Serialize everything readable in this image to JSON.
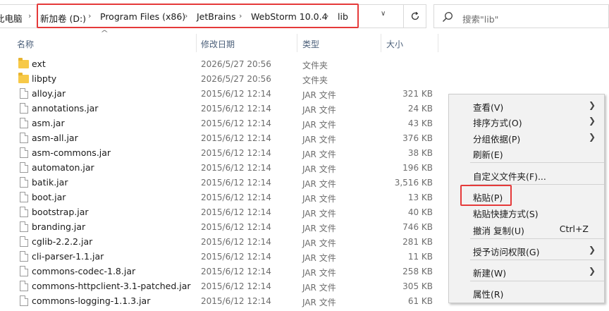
{
  "address_bar": {
    "crumbs": [
      "此电脑",
      "新加卷 (D:)",
      "Program Files (x86)",
      "JetBrains",
      "WebStorm 10.0.4",
      "lib"
    ]
  },
  "search": {
    "placeholder": "搜索\"lib\""
  },
  "columns": {
    "name": "名称",
    "date": "修改日期",
    "type": "类型",
    "size": "大小"
  },
  "files": [
    {
      "name": "ext",
      "date": "2026/5/27 20:56",
      "type": "文件夹",
      "size": "",
      "kind": "folder"
    },
    {
      "name": "libpty",
      "date": "2026/5/27 20:56",
      "type": "文件夹",
      "size": "",
      "kind": "folder"
    },
    {
      "name": "alloy.jar",
      "date": "2015/6/12 12:14",
      "type": "JAR 文件",
      "size": "321 KB",
      "kind": "file"
    },
    {
      "name": "annotations.jar",
      "date": "2015/6/12 12:14",
      "type": "JAR 文件",
      "size": "24 KB",
      "kind": "file"
    },
    {
      "name": "asm.jar",
      "date": "2015/6/12 12:14",
      "type": "JAR 文件",
      "size": "43 KB",
      "kind": "file"
    },
    {
      "name": "asm-all.jar",
      "date": "2015/6/12 12:14",
      "type": "JAR 文件",
      "size": "376 KB",
      "kind": "file"
    },
    {
      "name": "asm-commons.jar",
      "date": "2015/6/12 12:14",
      "type": "JAR 文件",
      "size": "38 KB",
      "kind": "file"
    },
    {
      "name": "automaton.jar",
      "date": "2015/6/12 12:14",
      "type": "JAR 文件",
      "size": "196 KB",
      "kind": "file"
    },
    {
      "name": "batik.jar",
      "date": "2015/6/12 12:14",
      "type": "JAR 文件",
      "size": "3,516 KB",
      "kind": "file"
    },
    {
      "name": "boot.jar",
      "date": "2015/6/12 12:14",
      "type": "JAR 文件",
      "size": "13 KB",
      "kind": "file"
    },
    {
      "name": "bootstrap.jar",
      "date": "2015/6/12 12:14",
      "type": "JAR 文件",
      "size": "40 KB",
      "kind": "file"
    },
    {
      "name": "branding.jar",
      "date": "2015/6/12 12:14",
      "type": "JAR 文件",
      "size": "746 KB",
      "kind": "file"
    },
    {
      "name": "cglib-2.2.2.jar",
      "date": "2015/6/12 12:14",
      "type": "JAR 文件",
      "size": "281 KB",
      "kind": "file"
    },
    {
      "name": "cli-parser-1.1.jar",
      "date": "2015/6/12 12:14",
      "type": "JAR 文件",
      "size": "11 KB",
      "kind": "file"
    },
    {
      "name": "commons-codec-1.8.jar",
      "date": "2015/6/12 12:14",
      "type": "JAR 文件",
      "size": "258 KB",
      "kind": "file"
    },
    {
      "name": "commons-httpclient-3.1-patched.jar",
      "date": "2015/6/12 12:14",
      "type": "JAR 文件",
      "size": "305 KB",
      "kind": "file"
    },
    {
      "name": "commons-logging-1.1.3.jar",
      "date": "2015/6/12 12:14",
      "type": "JAR 文件",
      "size": "61 KB",
      "kind": "file"
    }
  ],
  "context_menu": {
    "view": "查看(V)",
    "sort_by": "排序方式(O)",
    "group_by": "分组依据(P)",
    "refresh": "刷新(E)",
    "customize_folder": "自定义文件夹(F)...",
    "paste": "粘贴(P)",
    "paste_shortcut": "粘贴快捷方式(S)",
    "undo_copy": "撤消 复制(U)",
    "undo_copy_shortcut": "Ctrl+Z",
    "give_access": "授予访问权限(G)",
    "new": "新建(W)",
    "properties": "属性(R)"
  },
  "colors": {
    "highlight": "#e53a3a",
    "folder": "#f7c948",
    "header_text": "#4c607a"
  }
}
